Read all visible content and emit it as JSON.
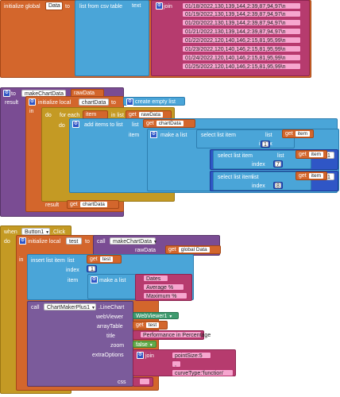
{
  "block1": {
    "initialize_global": "initialize global",
    "var_name": "Data",
    "to": "to",
    "list_from_csv_table": "list from csv table",
    "text": "text",
    "join": "join",
    "rows": [
      "01/18/2022,130,139,144,2:39,87,94,97\\n",
      "01/19/2022,130,139,144,2:39,87,94,97\\n",
      "01/20/2022,130,139,144,2:39,87,94,97\\n",
      "01/21/2022,130,139,144,2:39,87,94,97\\n",
      "01/22/2022,120,140,146,2:15,81,95,99\\n",
      "01/23/2022,120,140,146,2:15,81,95,99\\n",
      "01/24/2022,120,140,146,2:15,81,95,99\\n",
      "01/25/2022,120,140,146,2:15,81,95,99\\n"
    ]
  },
  "block2": {
    "to": "to",
    "proc_name": "makeChartData",
    "param": "rawData",
    "result": "result",
    "initialize_local": "initialize local",
    "local_var": "chartData",
    "to2": "to",
    "create_empty_list": "create empty list",
    "in": "in",
    "do": "do",
    "for_each": "for each",
    "item": "item",
    "in_list": "in list",
    "get": "get",
    "get_rawData": "rawData",
    "do2": "do",
    "add_items_to_list": "add items to list",
    "list": "list",
    "get_chartData": "chartData",
    "item_label": "item",
    "make_a_list": "make a list",
    "select_list_item": "select list item",
    "list2": "list",
    "get_item": "item",
    "index": "index",
    "idx1": "1",
    "times": "×",
    "one": "1",
    "idx7": "7",
    "idx8": "8",
    "result2": "result",
    "get_chartData2": "chartData"
  },
  "block3": {
    "when": "when",
    "component": "Button1",
    "event": ".Click",
    "do": "do",
    "initialize_local": "initialize local",
    "local_var": "test",
    "to": "to",
    "call": "call",
    "call_proc": "makeChartData",
    "rawData": "rawData",
    "get": "get",
    "get_global": "global Data",
    "in": "in",
    "insert_list_item": "insert list item",
    "list": "list",
    "get_test": "test",
    "index": "index",
    "index_val": "1",
    "item": "item",
    "make_a_list": "make a list",
    "labels": [
      "Dates",
      "Average %",
      "Maximum %"
    ],
    "call2": "call",
    "chart_component": "ChartMakerPlus1",
    "method": ".LineChart",
    "webViewer": "webViewer",
    "webViewer_val": "WebViewer1",
    "arrayTable": "arrayTable",
    "get_test2": "test",
    "title": "title",
    "title_val": "Performance in Percentage",
    "zoom": "zoom",
    "zoom_val": "false",
    "extraOptions": "extraOptions",
    "join": "join",
    "opt1": "pointSize:5",
    "opt2": ",",
    "opt3": "curveType:'function'",
    "css": "css",
    "css_val": ""
  },
  "colors": {
    "variables": "#d3662c",
    "lists": "#4aa5d8",
    "text": "#b63b6e",
    "procedures": "#7a4c93",
    "control": "#c49a24",
    "events": "#c49a24",
    "components": "#7b5b9b",
    "math": "#2f56c6",
    "logic": "#62ab4a"
  }
}
